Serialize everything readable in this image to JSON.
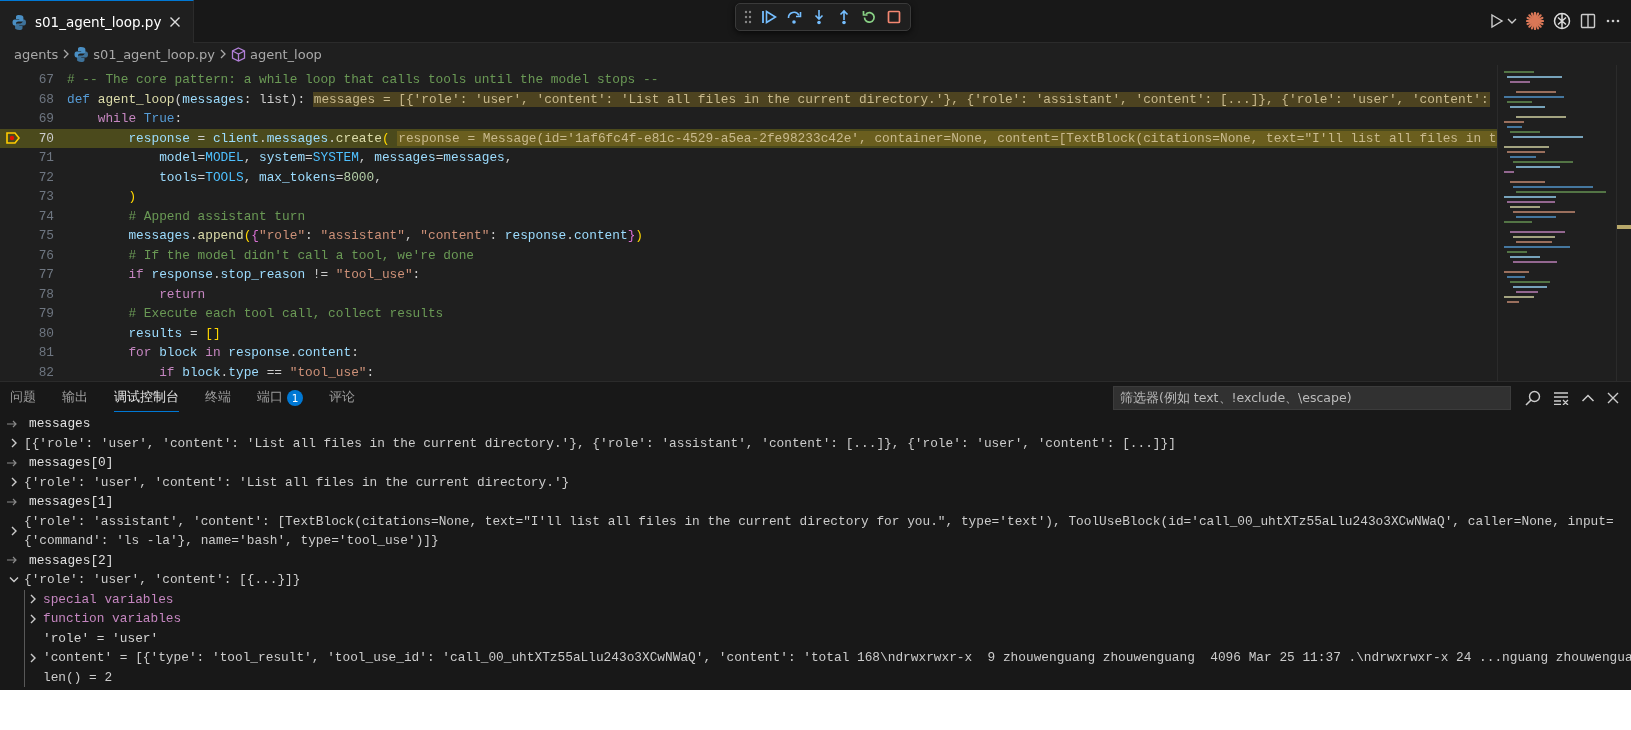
{
  "editor_tab": {
    "label": "s01_agent_loop.py",
    "selected": true
  },
  "breadcrumb": [
    {
      "label": "agents",
      "kind": "folder"
    },
    {
      "label": "s01_agent_loop.py",
      "kind": "file"
    },
    {
      "label": "agent_loop",
      "kind": "symbol"
    }
  ],
  "code_lines": [
    {
      "number": "67",
      "current": false,
      "tokens": [
        {
          "text": "# -- The core pattern: a while loop that calls tools until the model stops --",
          "kind": "comment"
        }
      ]
    },
    {
      "number": "68",
      "current": false,
      "tokens": [
        {
          "text": "def ",
          "kind": "storage"
        },
        {
          "text": "agent_loop",
          "kind": "func"
        },
        {
          "text": "(",
          "kind": "plain"
        },
        {
          "text": "messages",
          "kind": "var"
        },
        {
          "text": ": list):",
          "kind": "plain"
        }
      ],
      "inline_value": "messages = [{'role': 'user', 'content': 'List all files in the current directory.'}, {'role': 'assistant', 'content': [...]}, {'role': 'user', 'content':"
    },
    {
      "number": "69",
      "current": false,
      "tokens": [
        {
          "text": "    while ",
          "kind": "control"
        },
        {
          "text": "True",
          "kind": "storage"
        },
        {
          "text": ":",
          "kind": "plain"
        }
      ]
    },
    {
      "number": "70",
      "current": true,
      "tokens": [
        {
          "text": "        response",
          "kind": "var"
        },
        {
          "text": " = ",
          "kind": "plain"
        },
        {
          "text": "client",
          "kind": "var"
        },
        {
          "text": ".",
          "kind": "plain"
        },
        {
          "text": "messages",
          "kind": "var"
        },
        {
          "text": ".",
          "kind": "plain"
        },
        {
          "text": "create",
          "kind": "func"
        },
        {
          "text": "(",
          "kind": "bracket1"
        }
      ],
      "inline_value": "response = Message(id='1af6fc4f-e81c-4529-a5ea-2fe98233c42e', container=None, content=[TextBlock(citations=None, text=\"I'll list all files in t"
    },
    {
      "number": "71",
      "current": false,
      "tokens": [
        {
          "text": "            model",
          "kind": "var"
        },
        {
          "text": "=",
          "kind": "plain"
        },
        {
          "text": "MODEL",
          "kind": "const"
        },
        {
          "text": ", ",
          "kind": "plain"
        },
        {
          "text": "system",
          "kind": "var"
        },
        {
          "text": "=",
          "kind": "plain"
        },
        {
          "text": "SYSTEM",
          "kind": "const"
        },
        {
          "text": ", ",
          "kind": "plain"
        },
        {
          "text": "messages",
          "kind": "var"
        },
        {
          "text": "=",
          "kind": "plain"
        },
        {
          "text": "messages",
          "kind": "var"
        },
        {
          "text": ",",
          "kind": "plain"
        }
      ]
    },
    {
      "number": "72",
      "current": false,
      "tokens": [
        {
          "text": "            tools",
          "kind": "var"
        },
        {
          "text": "=",
          "kind": "plain"
        },
        {
          "text": "TOOLS",
          "kind": "const"
        },
        {
          "text": ", ",
          "kind": "plain"
        },
        {
          "text": "max_tokens",
          "kind": "var"
        },
        {
          "text": "=",
          "kind": "plain"
        },
        {
          "text": "8000",
          "kind": "number"
        },
        {
          "text": ",",
          "kind": "plain"
        }
      ]
    },
    {
      "number": "73",
      "current": false,
      "tokens": [
        {
          "text": "        )",
          "kind": "bracket1"
        }
      ]
    },
    {
      "number": "74",
      "current": false,
      "tokens": [
        {
          "text": "        # Append assistant turn",
          "kind": "comment"
        }
      ]
    },
    {
      "number": "75",
      "current": false,
      "tokens": [
        {
          "text": "        messages",
          "kind": "var"
        },
        {
          "text": ".",
          "kind": "plain"
        },
        {
          "text": "append",
          "kind": "func"
        },
        {
          "text": "(",
          "kind": "bracket1"
        },
        {
          "text": "{",
          "kind": "bracket2"
        },
        {
          "text": "\"role\"",
          "kind": "string"
        },
        {
          "text": ": ",
          "kind": "plain"
        },
        {
          "text": "\"assistant\"",
          "kind": "string"
        },
        {
          "text": ", ",
          "kind": "plain"
        },
        {
          "text": "\"content\"",
          "kind": "string"
        },
        {
          "text": ": ",
          "kind": "plain"
        },
        {
          "text": "response",
          "kind": "var"
        },
        {
          "text": ".",
          "kind": "plain"
        },
        {
          "text": "content",
          "kind": "var"
        },
        {
          "text": "}",
          "kind": "bracket2"
        },
        {
          "text": ")",
          "kind": "bracket1"
        }
      ]
    },
    {
      "number": "76",
      "current": false,
      "tokens": [
        {
          "text": "        # If the model didn't call a tool, we're done",
          "kind": "comment"
        }
      ]
    },
    {
      "number": "77",
      "current": false,
      "tokens": [
        {
          "text": "        if ",
          "kind": "control"
        },
        {
          "text": "response",
          "kind": "var"
        },
        {
          "text": ".",
          "kind": "plain"
        },
        {
          "text": "stop_reason",
          "kind": "var"
        },
        {
          "text": " != ",
          "kind": "plain"
        },
        {
          "text": "\"tool_use\"",
          "kind": "string"
        },
        {
          "text": ":",
          "kind": "plain"
        }
      ]
    },
    {
      "number": "78",
      "current": false,
      "tokens": [
        {
          "text": "            return",
          "kind": "control"
        }
      ]
    },
    {
      "number": "79",
      "current": false,
      "tokens": [
        {
          "text": "        # Execute each tool call, collect results",
          "kind": "comment"
        }
      ]
    },
    {
      "number": "80",
      "current": false,
      "tokens": [
        {
          "text": "        results",
          "kind": "var"
        },
        {
          "text": " = ",
          "kind": "plain"
        },
        {
          "text": "[]",
          "kind": "bracket1"
        }
      ]
    },
    {
      "number": "81",
      "current": false,
      "tokens": [
        {
          "text": "        for ",
          "kind": "control"
        },
        {
          "text": "block ",
          "kind": "var"
        },
        {
          "text": "in ",
          "kind": "control"
        },
        {
          "text": "response",
          "kind": "var"
        },
        {
          "text": ".",
          "kind": "plain"
        },
        {
          "text": "content",
          "kind": "var"
        },
        {
          "text": ":",
          "kind": "plain"
        }
      ]
    },
    {
      "number": "82",
      "current": false,
      "tokens": [
        {
          "text": "            if ",
          "kind": "control"
        },
        {
          "text": "block",
          "kind": "var"
        },
        {
          "text": ".",
          "kind": "plain"
        },
        {
          "text": "type",
          "kind": "var"
        },
        {
          "text": " == ",
          "kind": "plain"
        },
        {
          "text": "\"tool_use\"",
          "kind": "string"
        },
        {
          "text": ":",
          "kind": "plain"
        }
      ]
    }
  ],
  "panel": {
    "tabs": [
      {
        "label": "问题",
        "selected": false
      },
      {
        "label": "输出",
        "selected": false
      },
      {
        "label": "调试控制台",
        "selected": true
      },
      {
        "label": "终端",
        "selected": false
      },
      {
        "label": "端口",
        "selected": false,
        "badge": "1"
      },
      {
        "label": "评论",
        "selected": false
      }
    ],
    "filter": {
      "placeholder": "筛选器(例如 text、!exclude、\\escape)"
    },
    "console": [
      {
        "kind": "input",
        "text": "messages"
      },
      {
        "kind": "node",
        "expanded": false,
        "text": "[{'role': 'user', 'content': 'List all files in the current directory.'}, {'role': 'assistant', 'content': [...]}, {'role': 'user', 'content': [...]}]"
      },
      {
        "kind": "input",
        "text": "messages[0]"
      },
      {
        "kind": "node",
        "expanded": false,
        "text": "{'role': 'user', 'content': 'List all files in the current directory.'}"
      },
      {
        "kind": "input",
        "text": "messages[1]"
      },
      {
        "kind": "node",
        "expanded": false,
        "lines": [
          "{'role': 'assistant', 'content': [TextBlock(citations=None, text=\"I'll list all files in the current directory for you.\", type='text'), ToolUseBlock(id='call_00_uhtXTz55aLlu243o3XCwNWaQ', caller=None, input=",
          "{'command': 'ls -la'}, name='bash', type='tool_use')]}"
        ]
      },
      {
        "kind": "input",
        "text": "messages[2]"
      },
      {
        "kind": "node",
        "expanded": true,
        "text": "{'role': 'user', 'content': [{...}]}",
        "children": [
          {
            "kind": "group",
            "expanded": false,
            "text": "special variables"
          },
          {
            "kind": "group",
            "expanded": false,
            "text": "function variables"
          },
          {
            "kind": "property",
            "text": "'role' = 'user'"
          },
          {
            "kind": "node",
            "expanded": false,
            "text": "'content' = [{'type': 'tool_result', 'tool_use_id': 'call_00_uhtXTz55aLlu243o3XCwNWaQ', 'content': 'total 168\\ndrwxrwxr-x  9 zhouwenguang zhouwenguang  4096 Mar 25 11:37 .\\ndrwxrwxr-x 24 ...nguang zhouwengua"
          },
          {
            "kind": "leaf",
            "text": "len() = 2"
          }
        ]
      }
    ]
  }
}
